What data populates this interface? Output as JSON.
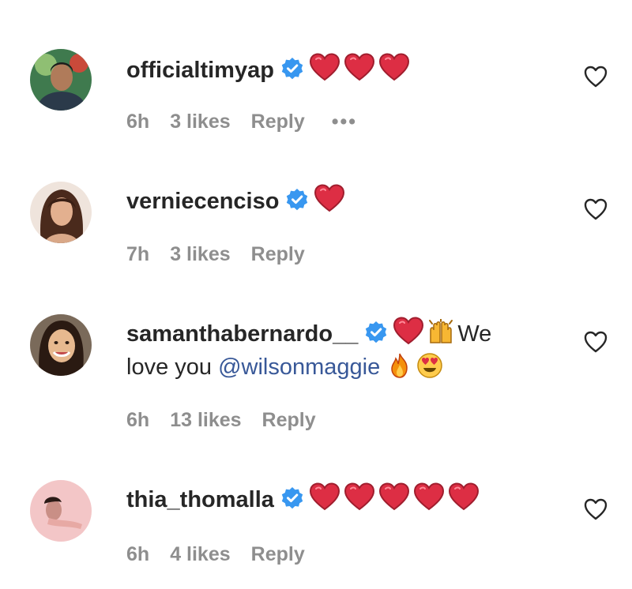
{
  "comments": [
    {
      "username": "officialtimyap",
      "verified": true,
      "text": "",
      "emojis": [
        "red-heart",
        "red-heart",
        "red-heart"
      ],
      "age": "6h",
      "likes": "3 likes",
      "reply": "Reply",
      "more": "•••"
    },
    {
      "username": "verniecenciso",
      "verified": true,
      "text": "",
      "emojis": [
        "red-heart"
      ],
      "age": "7h",
      "likes": "3 likes",
      "reply": "Reply"
    },
    {
      "username": "samanthabernardo__",
      "verified": true,
      "text_part1": "We",
      "text_part2": "love you",
      "mention": "@wilsonmaggie",
      "emojis": [
        "red-heart",
        "raising-hands",
        "fire",
        "heart-eyes"
      ],
      "age": "6h",
      "likes": "13 likes",
      "reply": "Reply"
    },
    {
      "username": "thia_thomalla",
      "verified": true,
      "text": "",
      "emojis": [
        "red-heart",
        "red-heart",
        "red-heart",
        "red-heart",
        "red-heart"
      ],
      "age": "6h",
      "likes": "4 likes",
      "reply": "Reply"
    }
  ],
  "colors": {
    "heart": "#dd2e44",
    "verified": "#3897f0",
    "meta": "#8e8e8e",
    "mention": "#385898"
  },
  "icons": [
    "heart-outline-icon",
    "verified-badge-icon"
  ]
}
